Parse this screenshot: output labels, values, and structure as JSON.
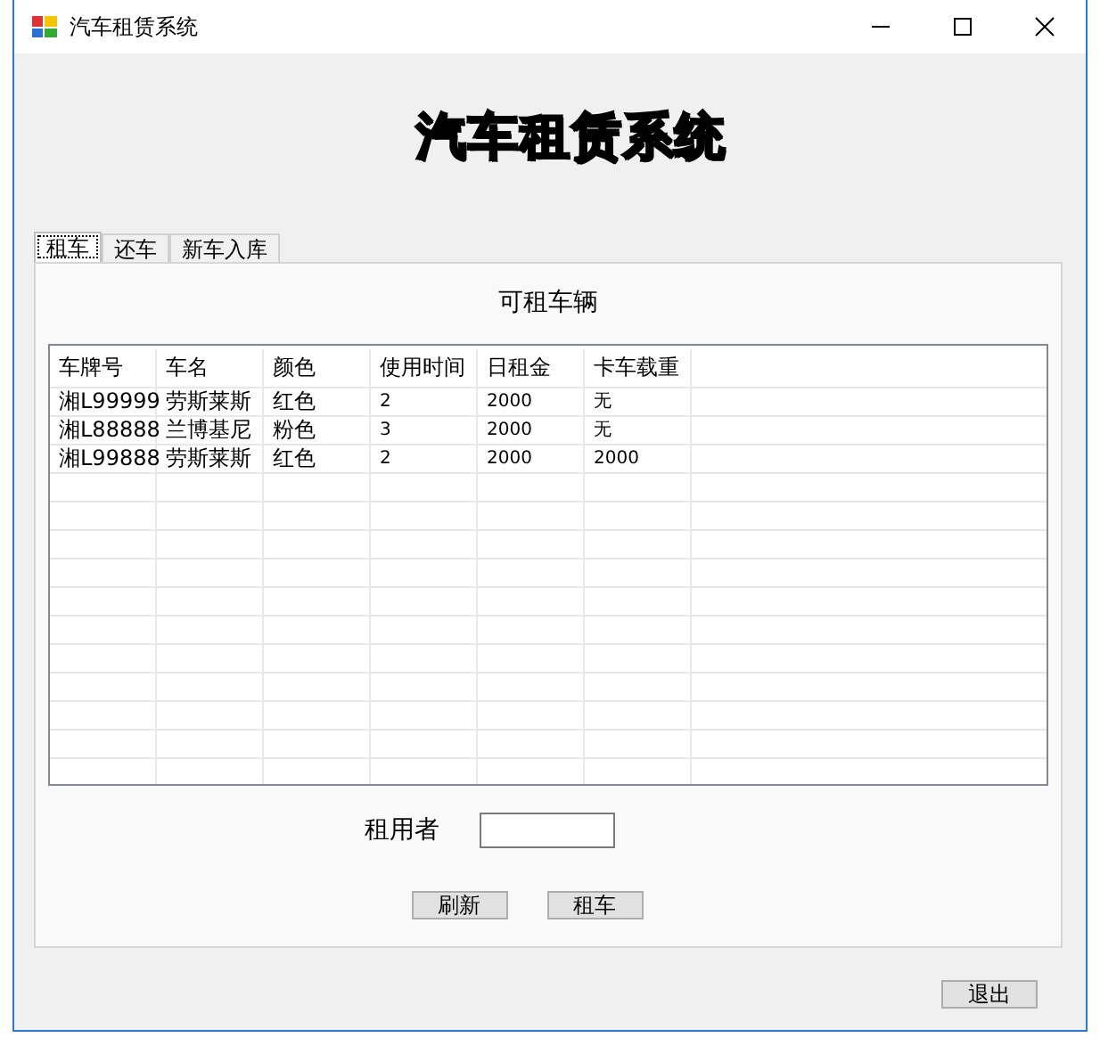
{
  "window": {
    "title": "汽车租赁系统"
  },
  "heading": "汽车租赁系统",
  "tabs": [
    {
      "label": "租车",
      "selected": true
    },
    {
      "label": "还车",
      "selected": false
    },
    {
      "label": "新车入库",
      "selected": false
    }
  ],
  "panel_title": "可租车辆",
  "table": {
    "columns": [
      "车牌号",
      "车名",
      "颜色",
      "使用时间",
      "日租金",
      "卡车载重"
    ],
    "rows": [
      [
        "湘L99999",
        "劳斯莱斯",
        "红色",
        "2",
        "2000",
        "无"
      ],
      [
        "湘L88888",
        "兰博基尼",
        "粉色",
        "3",
        "2000",
        "无"
      ],
      [
        "湘L99888",
        "劳斯莱斯",
        "红色",
        "2",
        "2000",
        "2000"
      ]
    ]
  },
  "renter": {
    "label": "租用者"
  },
  "buttons": [
    "刷新",
    "租车"
  ],
  "exit_button": "退出"
}
